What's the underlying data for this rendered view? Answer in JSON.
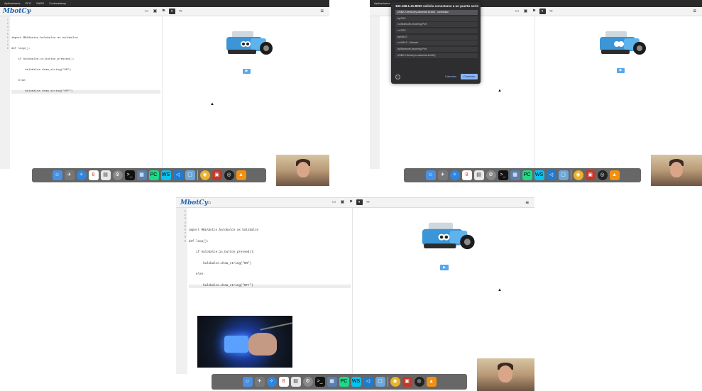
{
  "bookmarks": [
    "Aplicaciones",
    "PFG",
    "SARO",
    "Codecademy"
  ],
  "toolbar": {
    "logo": "MbotCy",
    "home_icon": "home-icon",
    "menu_icon": "menu-icon",
    "tools": [
      "panel-icon",
      "board-icon",
      "blocks-icon",
      "python-icon",
      "link-icon"
    ],
    "active_tool": 3
  },
  "editor": {
    "line_numbers": [
      "1",
      "2",
      "3",
      "4",
      "5",
      "6",
      "7",
      "8",
      "9"
    ],
    "lines": [
      "",
      "import MBLAbotcs.halobalce as halobalce",
      "def loop():",
      "    if halobalce.is_button_pressed():",
      "        halobalce.draw_string(\"ON\")",
      "    else:",
      "        halobalce.draw_string(\"OFF\")",
      "",
      ""
    ],
    "highlighted_line": 6
  },
  "run_button": "▶",
  "dock_apps": [
    "Finder",
    "Launchpad",
    "Safari",
    "Calendar",
    "Preview",
    "Settings",
    "Terminal",
    "Notes",
    "PyCharm",
    "WebStorm",
    "VS Code",
    "VirtualBox",
    "Chrome",
    "Photo",
    "OBS",
    "VLC"
  ],
  "dialog": {
    "title": "192.168.1.41:8000 solicita conectarse a un puerto serie",
    "ports": [
      "USB2.0-Serial (tty.usbserial-14440) - conectado",
      "tty.SOC",
      "cu.Bluetooth-Incoming-Port",
      "cu.SOC",
      "tty.MALS",
      "cu.MALS - Ubicado",
      "tty.Bluetooth-Incoming-Port",
      "USB2.0-Serial (cu.usbserial-14440)"
    ],
    "selected": 0,
    "cancel": "Cancelar",
    "connect": "Conectar",
    "help_icon": "help-icon"
  },
  "colors": {
    "accent": "#5aa6ea",
    "logo": "#1e63ad",
    "dialog_bg": "#2e2e30"
  }
}
